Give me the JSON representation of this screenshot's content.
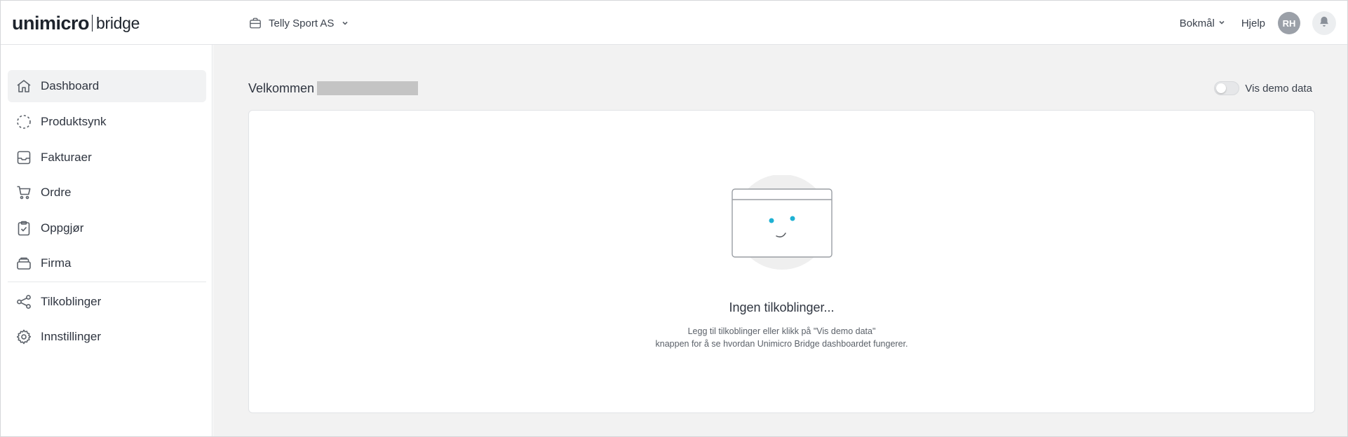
{
  "header": {
    "logo_main": "unimicro",
    "logo_sub": "bridge",
    "company": "Telly Sport AS",
    "language": "Bokmål",
    "help": "Hjelp",
    "avatar_initials": "RH"
  },
  "sidebar": {
    "items": [
      {
        "label": "Dashboard",
        "icon": "home-icon",
        "active": true
      },
      {
        "label": "Produktsynk",
        "icon": "sync-icon"
      },
      {
        "label": "Fakturaer",
        "icon": "inbox-icon"
      },
      {
        "label": "Ordre",
        "icon": "cart-icon"
      },
      {
        "label": "Oppgjør",
        "icon": "clipboard-check-icon"
      },
      {
        "label": "Firma",
        "icon": "building-icon"
      },
      {
        "label": "Tilkoblinger",
        "icon": "share-icon"
      },
      {
        "label": "Innstillinger",
        "icon": "gear-icon"
      }
    ]
  },
  "main": {
    "welcome": "Velkommen",
    "demo_toggle_label": "Vis demo data",
    "demo_toggle_on": false,
    "empty_title": "Ingen tilkoblinger...",
    "empty_desc_line1": "Legg til tilkoblinger eller klikk på \"Vis demo data\"",
    "empty_desc_line2": "knappen for å se hvordan Unimicro Bridge dashboardet fungerer."
  },
  "colors": {
    "accent_eyes": "#1fb1d3",
    "active_bg": "#f1f2f3",
    "main_bg": "#f2f2f2"
  }
}
